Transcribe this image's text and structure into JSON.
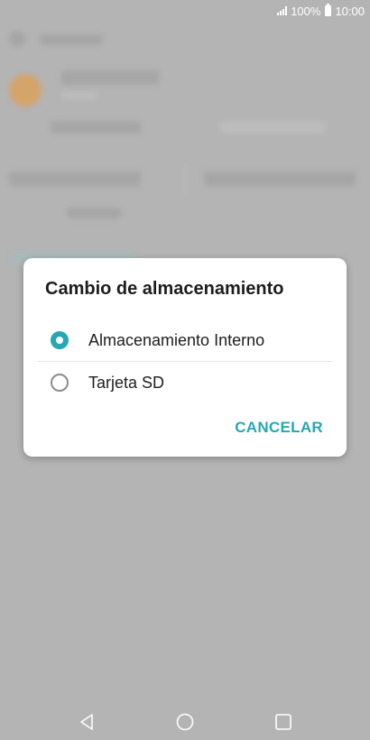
{
  "status_bar": {
    "battery_text": "100%",
    "time": "10:00",
    "icons": [
      "signal-icon",
      "battery-icon"
    ]
  },
  "dialog": {
    "title": "Cambio de almacenamiento",
    "options": [
      {
        "label": "Almacenamiento Interno",
        "selected": true
      },
      {
        "label": "Tarjeta SD",
        "selected": false
      }
    ],
    "cancel_label": "CANCELAR"
  },
  "nav_bar": {
    "icons": [
      "back-icon",
      "home-icon",
      "recent-apps-icon"
    ]
  },
  "colors": {
    "accent": "#25a8b3",
    "scrim": "#b4b4b4",
    "dialog_bg": "#ffffff"
  }
}
